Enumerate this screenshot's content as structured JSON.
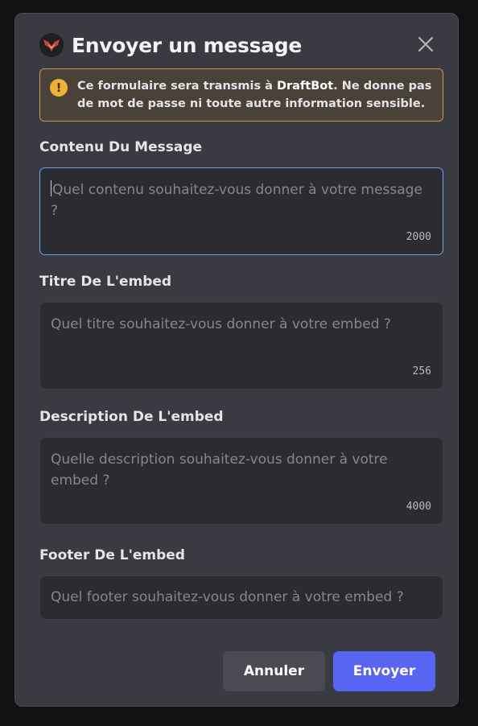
{
  "modal": {
    "title": "Envoyer un message",
    "avatar_icon": "draftbot-logo-icon",
    "close_icon": "close-icon"
  },
  "warning": {
    "icon": "exclamation-icon",
    "text_before": "Ce formulaire sera transmis à ",
    "bot_name": "DraftBot",
    "text_after": ". Ne donne pas de mot de passe ni toute autre information sensible."
  },
  "fields": [
    {
      "label": "Contenu Du Message",
      "placeholder": "Quel contenu souhaitez-vous donner à votre message ?",
      "counter": "2000"
    },
    {
      "label": "Titre De L'embed",
      "placeholder": "Quel titre souhaitez-vous donner à votre embed ?",
      "counter": "256"
    },
    {
      "label": "Description De L'embed",
      "placeholder": "Quelle description souhaitez-vous donner à votre embed ?",
      "counter": "4000"
    },
    {
      "label": "Footer De L'embed",
      "placeholder": "Quel footer souhaitez-vous donner à votre embed ?",
      "counter": ""
    }
  ],
  "buttons": {
    "cancel_label": "Annuler",
    "submit_label": "Envoyer"
  },
  "colors": {
    "accent": "#5865f2",
    "focus_border": "#6aa0e6",
    "warning_border": "#c89a4a",
    "warning_icon": "#f0b232"
  }
}
